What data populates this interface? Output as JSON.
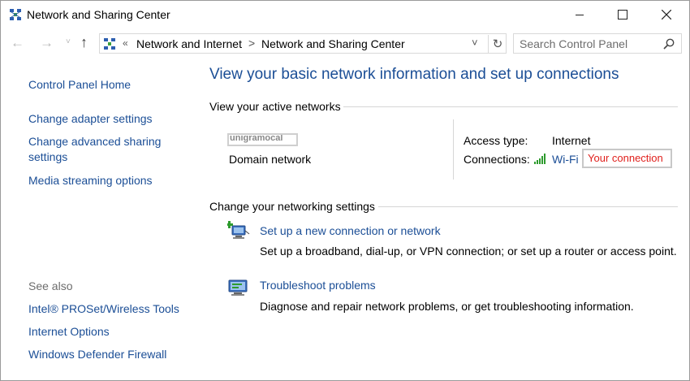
{
  "window": {
    "title": "Network and Sharing Center",
    "controls": {
      "minimize": "minimize",
      "maximize": "maximize",
      "close": "close"
    }
  },
  "nav": {
    "back": "←",
    "forward": "→",
    "recent": "˅",
    "up": "↑",
    "breadcrumb": {
      "chevron": "«",
      "items": [
        "Network and Internet",
        "Network and Sharing Center"
      ],
      "separator": ">"
    },
    "dropdown": "˅",
    "refresh": "↻",
    "search": {
      "placeholder": "Search Control Panel"
    }
  },
  "left_pane": {
    "links": [
      "Control Panel Home",
      "Change adapter settings",
      "Change advanced sharing settings",
      "Media streaming options"
    ],
    "see_also": {
      "heading": "See also",
      "items": [
        "Intel® PROSet/Wireless Tools",
        "Internet Options",
        "Windows Defender Firewall"
      ]
    }
  },
  "main": {
    "title": "View your basic network information and set up connections",
    "active_networks": {
      "heading": "View your active networks",
      "network_name": "unigramocal",
      "network_type": "Domain network",
      "access_type_label": "Access type:",
      "access_type_value": "Internet",
      "connections_label": "Connections:",
      "connection_link": "Wi-Fi",
      "annotation": "Your connection"
    },
    "change_settings": {
      "heading": "Change your networking settings",
      "tasks": [
        {
          "title": "Set up a new connection or network",
          "description": "Set up a broadband, dial-up, or VPN connection; or set up a router or access point."
        },
        {
          "title": "Troubleshoot problems",
          "description": "Diagnose and repair network problems, or get troubleshooting information."
        }
      ]
    }
  },
  "colors": {
    "link": "#1b4e96",
    "annotation": "#e0201c",
    "wifi": "#2e9b2e"
  }
}
